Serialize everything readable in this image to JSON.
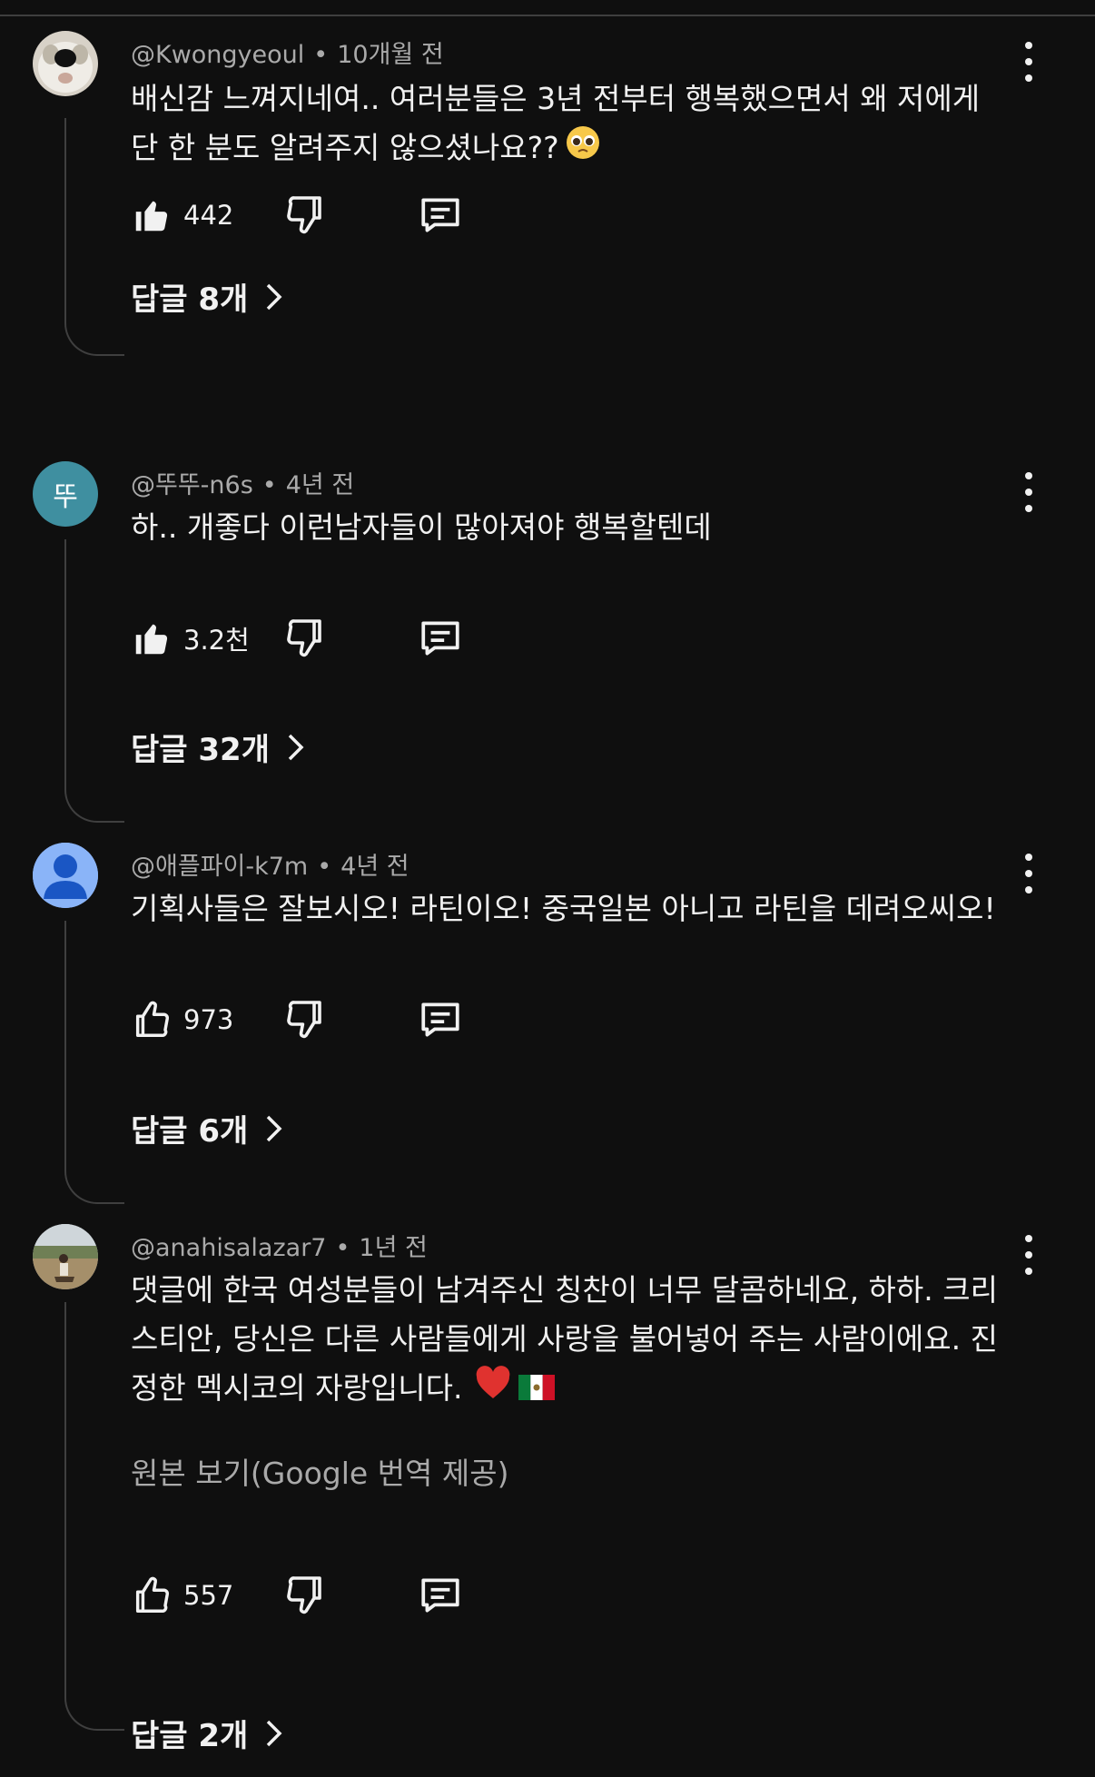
{
  "comments": [
    {
      "handle": "@Kwongyeoul",
      "time": "10개월 전",
      "lines": [
        "배신감 느껴지네여.. 여러분들은 3년 전부터 행복했으면서 왜 저에게",
        "단 한 분도 알려주지 않으셨나요??"
      ],
      "likes": "442",
      "replies": "답글 8개",
      "avatar_icon": "dog-photo-avatar",
      "liked": true
    },
    {
      "handle": "@뚜뚜-n6s",
      "time": "4년 전",
      "lines": [
        "하.. 개좋다 이런남자들이 많아져야 행복할텐데"
      ],
      "likes": "3.2천",
      "replies": "답글 32개",
      "avatar_letter": "뚜",
      "liked": true
    },
    {
      "handle": "@애플파이-k7m",
      "time": "4년 전",
      "lines": [
        "기획사들은 잘보시오! 라틴이오! 중국일본 아니고 라틴을 데려오씨오!"
      ],
      "likes": "973",
      "replies": "답글 6개",
      "avatar_icon": "default-person-avatar",
      "liked": false
    },
    {
      "handle": "@anahisalazar7",
      "time": "1년 전",
      "lines": [
        "댓글에 한국 여성분들이 남겨주신 칭찬이 너무 달콤하네요, 하하. 크리",
        "스티안, 당신은 다른 사람들에게 사랑을 불어넣어 주는 사람이에요. 진",
        "정한 멕시코의 자랑입니다."
      ],
      "translate": "원본 보기(Google 번역 제공)",
      "likes": "557",
      "replies": "답글 2개",
      "avatar_icon": "outdoor-photo-avatar",
      "liked": false
    }
  ],
  "colors": {
    "background": "#0f0f0f",
    "text": "#f1f1f1",
    "secondary_text": "#aaaaaa",
    "thread_line": "#3f3f3f",
    "letter_avatar": "#3f8fa0",
    "default_avatar": "#8ab4f8"
  },
  "icons": [
    "thumbs-up-icon",
    "thumbs-down-icon",
    "reply-icon",
    "more-vert-icon",
    "chevron-right-icon",
    "pleading-face-emoji",
    "red-heart-emoji",
    "mexico-flag-emoji"
  ]
}
